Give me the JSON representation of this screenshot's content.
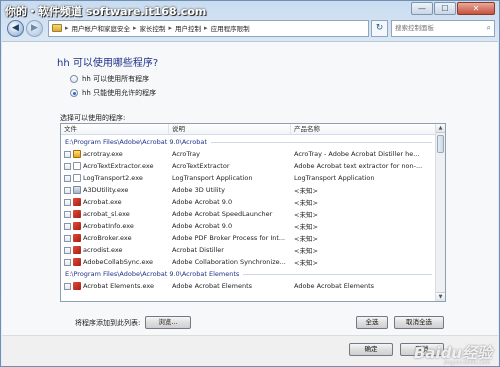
{
  "watermark": {
    "top_text": "你的・软件频道 software.it168.com",
    "bottom_text": "Baidu经验",
    "bottom_sub": "jingyan.baidu.com"
  },
  "window": {
    "minimize": "—",
    "maximize": "☐",
    "close": "✕"
  },
  "nav": {
    "back": "◀",
    "forward": "▶",
    "crumbs": [
      "用户帐户和家庭安全",
      "家长控制",
      "用户控制",
      "应用程序限制"
    ],
    "separator": "▸",
    "refresh": "↻",
    "search_placeholder": "搜索控制面板",
    "search_icon": "search-icon"
  },
  "main": {
    "heading": "hh 可以使用哪些程序?",
    "options": [
      {
        "label": "hh 可以使用所有程序",
        "checked": false
      },
      {
        "label": "hh 只能使用允许的程序",
        "checked": true
      }
    ],
    "list_label": "选择可以使用的程序:",
    "columns": [
      "文件",
      "说明",
      "产品名称"
    ],
    "groups": [
      {
        "path": "E:\\Program Files\\Adobe\\Acrobat 9.0\\Acrobat",
        "items": [
          {
            "file": "acrotray.exe",
            "desc": "AcroTray",
            "product": "AcroTray - Adobe Acrobat Distiller he...",
            "icon": "yellow"
          },
          {
            "file": "AcroTextExtractor.exe",
            "desc": "AcroTextExtractor",
            "product": "Adobe Acrobat text extractor for non-...",
            "icon": "doc"
          },
          {
            "file": "LogTransport2.exe",
            "desc": "LogTransport Application",
            "product": "LogTransport Application",
            "icon": "doc"
          },
          {
            "file": "A3DUtility.exe",
            "desc": "Adobe 3D Utility",
            "product": "<未知>",
            "icon": "gen"
          },
          {
            "file": "Acrobat.exe",
            "desc": "Adobe Acrobat 9.0",
            "product": "<未知>",
            "icon": "acro"
          },
          {
            "file": "acrobat_sl.exe",
            "desc": "Adobe Acrobat SpeedLauncher",
            "product": "<未知>",
            "icon": "acro"
          },
          {
            "file": "AcrobatInfo.exe",
            "desc": "Adobe Acrobat 9.0",
            "product": "<未知>",
            "icon": "acro"
          },
          {
            "file": "AcroBroker.exe",
            "desc": "Adobe PDF Broker Process for Int...",
            "product": "<未知>",
            "icon": "acro"
          },
          {
            "file": "acrodist.exe",
            "desc": "Acrobat  Distiller",
            "product": "<未知>",
            "icon": "acro"
          },
          {
            "file": "AdobeCollabSync.exe",
            "desc": "Adobe Collaboration Synchronize...",
            "product": "<未知>",
            "icon": "acro"
          }
        ]
      },
      {
        "path": "E:\\Program Files\\Adobe\\Acrobat 9.0\\Acrobat Elements",
        "items": [
          {
            "file": "Acrobat Elements.exe",
            "desc": "Adobe Acrobat Elements",
            "product": "Adobe Acrobat Elements",
            "icon": "acro"
          }
        ]
      }
    ],
    "add_label": "将程序添加到此列表:",
    "browse_button": "浏览...",
    "select_all_button": "全选",
    "deselect_all_button": "取消全选"
  },
  "footer": {
    "ok_button": "确定",
    "cancel_button": "取消"
  },
  "colors": {
    "heading": "#1e3287",
    "group_path": "#1e3287"
  }
}
